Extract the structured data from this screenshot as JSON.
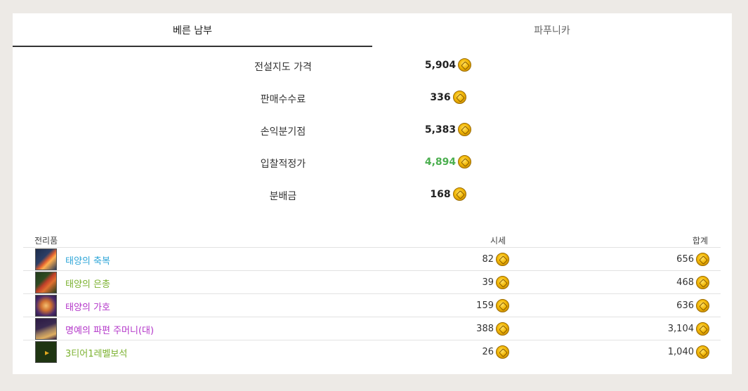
{
  "tabs": [
    {
      "label": "베른 남부",
      "active": true
    },
    {
      "label": "파푸니카",
      "active": false
    }
  ],
  "summary": [
    {
      "label": "전설지도 가격",
      "value": "5,904",
      "color": "#222222"
    },
    {
      "label": "판매수수료",
      "value": "336",
      "color": "#222222"
    },
    {
      "label": "손익분기점",
      "value": "5,383",
      "color": "#222222"
    },
    {
      "label": "입찰적정가",
      "value": "4,894",
      "color": "#4caf50"
    },
    {
      "label": "분배금",
      "value": "168",
      "color": "#222222"
    }
  ],
  "loot": {
    "headers": {
      "item": "전리품",
      "price": "시세",
      "total": "합계"
    },
    "rows": [
      {
        "name": "태양의 축복",
        "color": "#2fa6d8",
        "price": "82",
        "total": "656",
        "icon": "sun-blessing-icon"
      },
      {
        "name": "태양의 은총",
        "color": "#7bb12f",
        "price": "39",
        "total": "468",
        "icon": "sun-grace-icon"
      },
      {
        "name": "태양의 가호",
        "color": "#b336c9",
        "price": "159",
        "total": "636",
        "icon": "sun-protection-icon"
      },
      {
        "name": "명예의 파편 주머니(대)",
        "color": "#b336c9",
        "price": "388",
        "total": "3,104",
        "icon": "honor-shard-pouch-icon"
      },
      {
        "name": "3티어1레벨보석",
        "color": "#7bb12f",
        "price": "26",
        "total": "1,040",
        "icon": "gem-icon"
      }
    ]
  },
  "currency_icon": "gold-coin-icon"
}
